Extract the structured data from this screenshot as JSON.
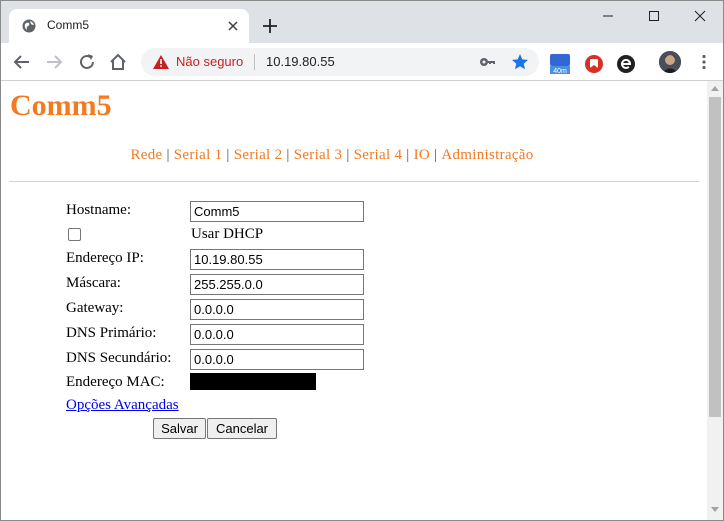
{
  "tab": {
    "title": "Comm5"
  },
  "address_bar": {
    "security_label": "Não seguro",
    "url": "10.19.80.55"
  },
  "extensions": {
    "timer_badge": "40m"
  },
  "page": {
    "brand": "Comm5",
    "nav": [
      "Rede",
      "Serial 1",
      "Serial 2",
      "Serial 3",
      "Serial 4",
      "IO",
      "Administração"
    ],
    "form": {
      "hostname_label": "Hostname:",
      "hostname_value": "Comm5",
      "dhcp_label": "Usar DHCP",
      "dhcp_checked": false,
      "ip_label": "Endereço IP:",
      "ip_value": "10.19.80.55",
      "mask_label": "Máscara:",
      "mask_value": "255.255.0.0",
      "gateway_label": "Gateway:",
      "gateway_value": "0.0.0.0",
      "dns1_label": "DNS Primário:",
      "dns1_value": "0.0.0.0",
      "dns2_label": "DNS Secundário:",
      "dns2_value": "0.0.0.0",
      "mac_label": "Endereço MAC:",
      "advanced_link": "Opções Avançadas",
      "save_label": "Salvar",
      "cancel_label": "Cancelar"
    }
  },
  "colors": {
    "brand": "#f47920",
    "link": "#0000ee",
    "warning": "#c5221f"
  }
}
